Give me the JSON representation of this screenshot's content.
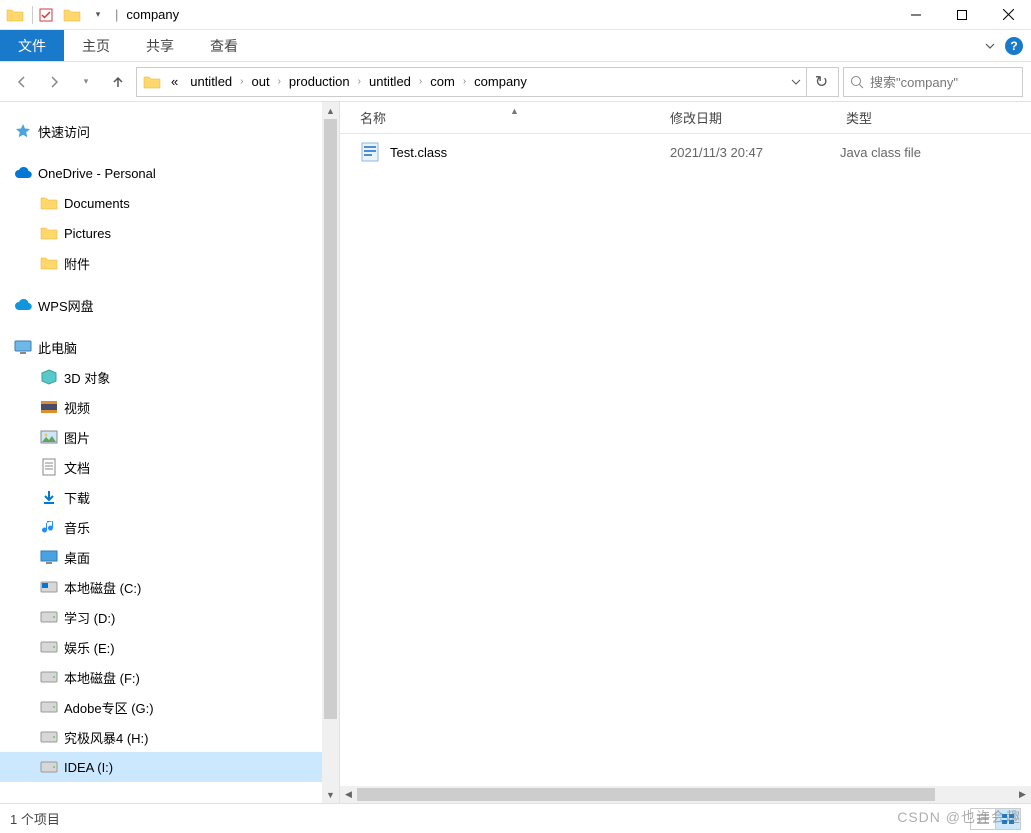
{
  "title": "company",
  "ribbon": {
    "file": "文件",
    "tabs": [
      "主页",
      "共享",
      "查看"
    ]
  },
  "breadcrumbs": {
    "prefix": "«",
    "items": [
      "untitled",
      "out",
      "production",
      "untitled",
      "com",
      "company"
    ]
  },
  "search": {
    "placeholder": "搜索\"company\""
  },
  "sidebar": {
    "quick_access": "快速访问",
    "onedrive": "OneDrive - Personal",
    "onedrive_children": [
      "Documents",
      "Pictures",
      "附件"
    ],
    "wps": "WPS网盘",
    "this_pc": "此电脑",
    "this_pc_children": [
      {
        "label": "3D 对象",
        "icon": "3d"
      },
      {
        "label": "视频",
        "icon": "video"
      },
      {
        "label": "图片",
        "icon": "pic"
      },
      {
        "label": "文档",
        "icon": "doc"
      },
      {
        "label": "下载",
        "icon": "dl"
      },
      {
        "label": "音乐",
        "icon": "music"
      },
      {
        "label": "桌面",
        "icon": "desk"
      },
      {
        "label": "本地磁盘 (C:)",
        "icon": "drivewin"
      },
      {
        "label": "学习 (D:)",
        "icon": "drive"
      },
      {
        "label": "娱乐 (E:)",
        "icon": "drive"
      },
      {
        "label": "本地磁盘 (F:)",
        "icon": "drive"
      },
      {
        "label": "Adobe专区 (G:)",
        "icon": "drive"
      },
      {
        "label": "究极风暴4 (H:)",
        "icon": "drive"
      },
      {
        "label": "IDEA (I:)",
        "icon": "drive",
        "selected": true
      }
    ]
  },
  "columns": {
    "name": "名称",
    "date": "修改日期",
    "type": "类型"
  },
  "files": [
    {
      "name": "Test.class",
      "date": "2021/11/3 20:47",
      "type": "Java class file"
    }
  ],
  "status": {
    "count": "1 个项目"
  },
  "watermark": "CSDN @也许会趣"
}
